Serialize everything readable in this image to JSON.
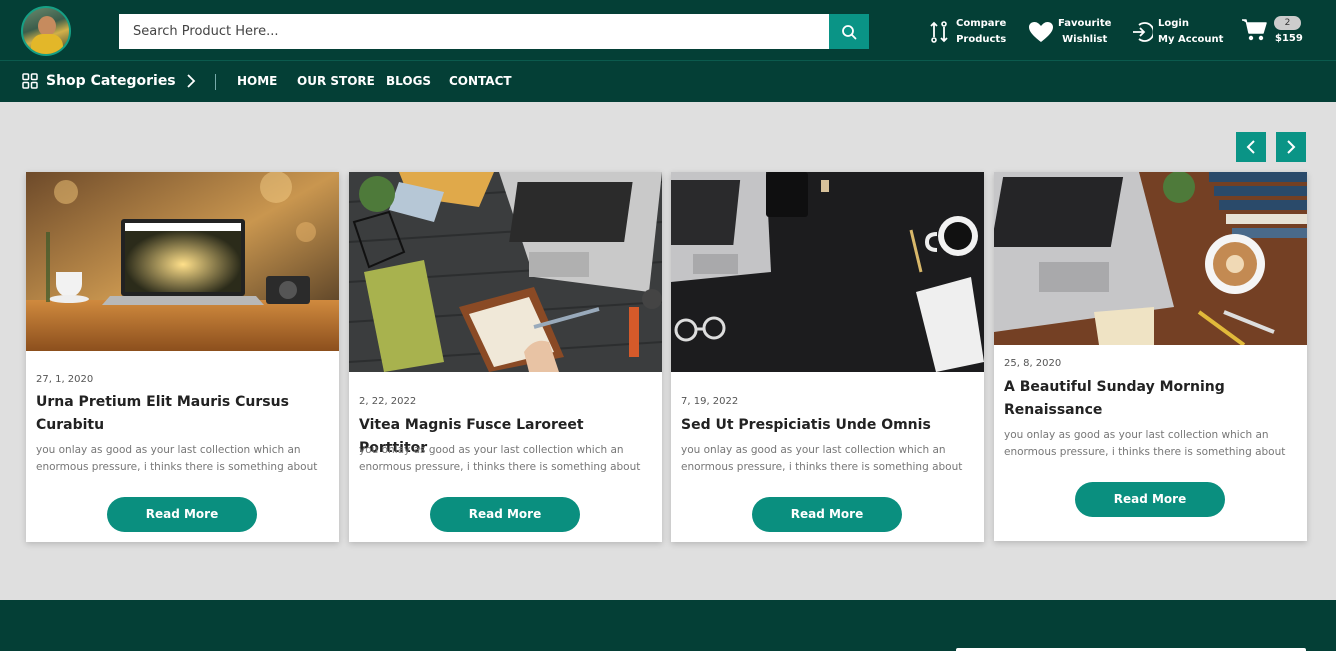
{
  "header": {
    "search": {
      "placeholder": "Search Product Here..."
    },
    "compare": {
      "line1": "Compare",
      "line2": "Products"
    },
    "wishlist": {
      "line1": "Favourite",
      "line2": "Wishlist"
    },
    "login": {
      "line1": "Login",
      "line2": "My Account"
    },
    "cart": {
      "count": "2",
      "total": "$159"
    }
  },
  "nav": {
    "categories_label": "Shop Categories",
    "links": [
      "HOME",
      "OUR STORE",
      "BLOGS",
      "CONTACT"
    ]
  },
  "colors": {
    "header_bg": "#043f36",
    "accent": "#0a9486",
    "page_bg": "#dfdfdf"
  },
  "blogs": [
    {
      "date": "27, 1, 2020",
      "title": "Urna Pretium Elit Mauris Cursus Curabitu",
      "desc": "you onlay as good as your last collection which an enormous pressure, i thinks there is something about",
      "button": "Read More"
    },
    {
      "date": "2, 22, 2022",
      "title": "Vitea Magnis Fusce Laroreet Porttitor",
      "desc": "you onlay as good as your last collection which an enormous pressure, i thinks there is something about",
      "button": "Read More"
    },
    {
      "date": "7, 19, 2022",
      "title": "Sed Ut Prespiciatis Unde Omnis",
      "desc": "you onlay as good as your last collection which an enormous pressure, i thinks there is something about",
      "button": "Read More"
    },
    {
      "date": "25, 8, 2020",
      "title": "A Beautiful Sunday Morning Renaissance",
      "desc": "you onlay as good as your last collection which an enormous pressure, i thinks there is something about",
      "button": "Read More"
    }
  ]
}
